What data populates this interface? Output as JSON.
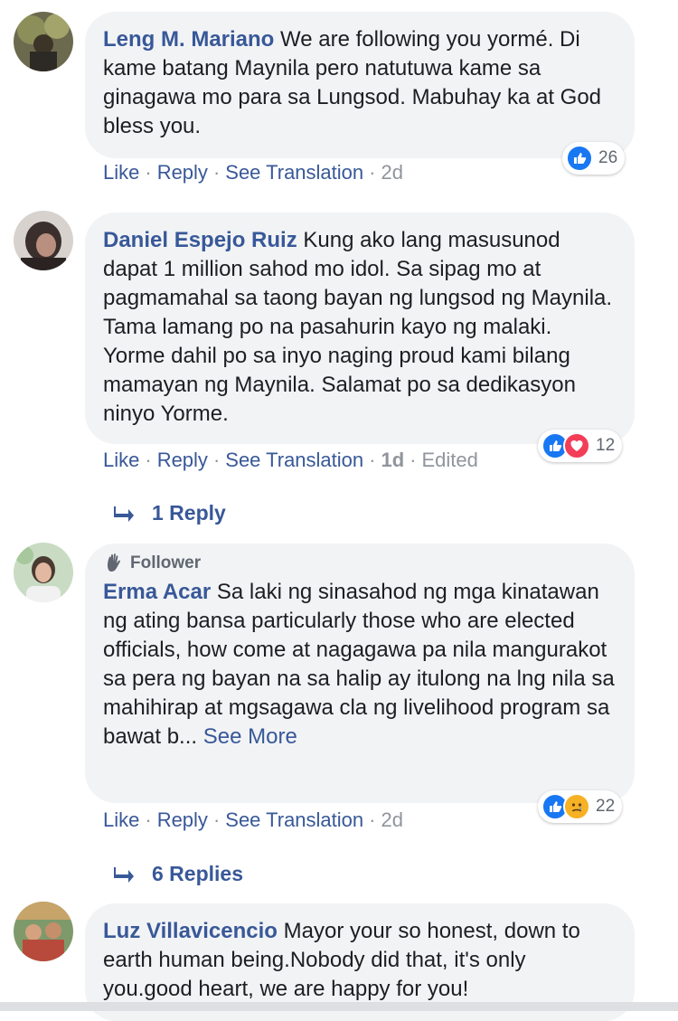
{
  "actions": {
    "like": "Like",
    "reply": "Reply",
    "see_translation": "See Translation",
    "sep": "·"
  },
  "comments": [
    {
      "author": "Leng M. Mariano",
      "text": "We are following you yormé. Di kame batang Maynila pero natutuwa kame sa ginagawa mo para sa Lungsod. Mabuhay ka at God bless you.",
      "time": "2d",
      "reaction_count": "26",
      "reactions": [
        "like-icon"
      ]
    },
    {
      "author": "Daniel Espejo Ruiz",
      "text": "Kung ako lang masusunod dapat 1 million sahod mo idol. Sa sipag mo at pagmamahal sa taong bayan ng lungsod ng Maynila. Tama lamang po na pasahurin kayo ng malaki. Yorme dahil po sa inyo naging proud kami bilang mamayan ng Maynila. Salamat po sa dedikasyon ninyo Yorme.",
      "time": "1d",
      "edited": "Edited",
      "reaction_count": "12",
      "reactions": [
        "like-icon",
        "love-icon"
      ],
      "replies_label": "1 Reply"
    },
    {
      "badge": "Follower",
      "author": "Erma Acar",
      "text": "Sa laki ng sinasahod ng mga kinatawan ng ating bansa particularly those who are elected officials, how come at nagagawa pa nila mangurakot sa pera ng bayan na sa halip ay itulong na lng nila sa mahihirap at mgsagawa cla ng livelihood program sa bawat b...",
      "see_more": "See More",
      "time": "2d",
      "reaction_count": "22",
      "reactions": [
        "like-icon",
        "sad-icon"
      ],
      "replies_label": "6 Replies"
    },
    {
      "author": "Luz Villavicencio",
      "text": "Mayor your so honest, down to earth human being.Nobody did that, it's only you.good heart, we are happy for you!"
    }
  ],
  "colors": {
    "link": "#385898",
    "bubble": "#f2f3f5",
    "like": "#1877f2",
    "love": "#f33e58",
    "meta": "#90949c"
  }
}
